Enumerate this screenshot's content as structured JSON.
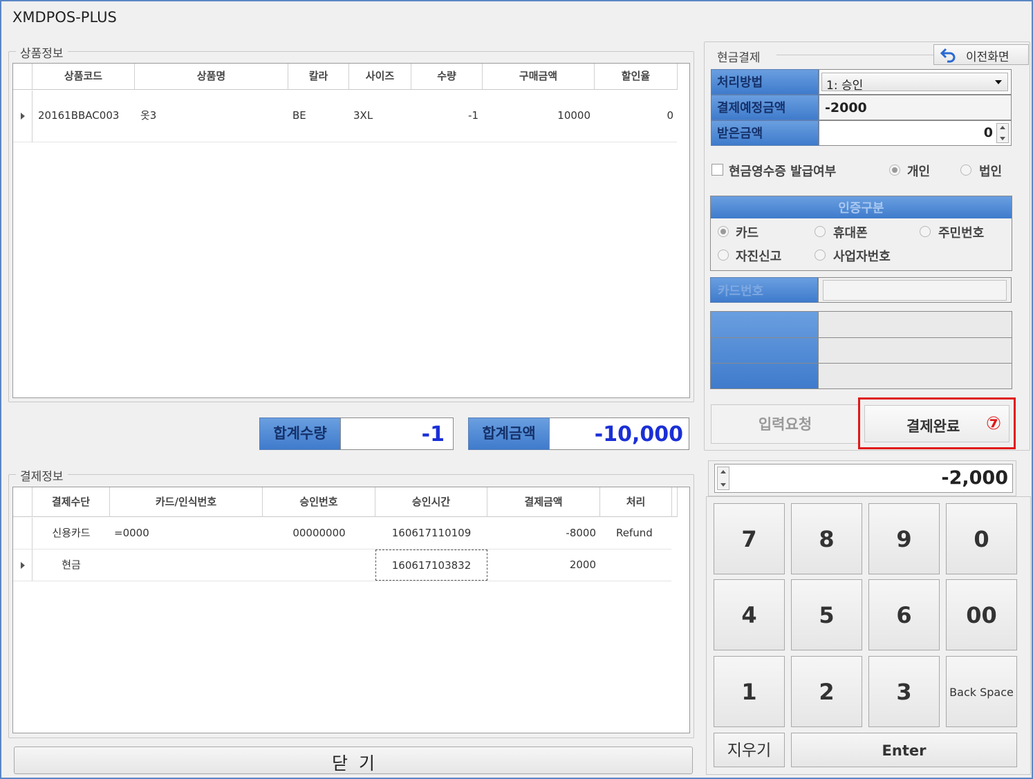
{
  "app": {
    "title": "XMDPOS-PLUS"
  },
  "product_info": {
    "legend": "상품정보",
    "columns": [
      "상품코드",
      "상품명",
      "칼라",
      "사이즈",
      "수량",
      "구매금액",
      "할인율"
    ],
    "rows": [
      {
        "code": "20161BBAC003",
        "name": "옷3",
        "color": "BE",
        "size": "3XL",
        "qty": "-1",
        "amount": "10000",
        "discount": "0"
      }
    ]
  },
  "totals": {
    "qty_label": "합계수량",
    "qty_value": "-1",
    "amount_label": "합계금액",
    "amount_value": "-10,000"
  },
  "payment_info": {
    "legend": "결제정보",
    "columns": [
      "결제수단",
      "카드/인식번호",
      "승인번호",
      "승인시간",
      "결제금액",
      "처리"
    ],
    "rows": [
      {
        "method": "신용카드",
        "card": "=0000",
        "approval_no": "00000000",
        "approval_time": "160617110109",
        "amount": "-8000",
        "process": "Refund"
      },
      {
        "method": "현금",
        "card": "",
        "approval_no": "",
        "approval_time": "160617103832",
        "amount": "2000",
        "process": ""
      }
    ]
  },
  "close_button": "닫  기",
  "cash_payment": {
    "legend": "현금결제",
    "back_button": "이전화면",
    "process_method_label": "처리방법",
    "process_method_value": "1: 승인",
    "expected_amount_label": "결제예정금액",
    "expected_amount_value": "-2000",
    "received_amount_label": "받은금액",
    "received_amount_value": "0",
    "receipt_checkbox_label": "현금영수증 발급여부",
    "receipt_type_personal": "개인",
    "receipt_type_business": "법인",
    "auth_type_title": "인증구분",
    "auth_options": [
      "카드",
      "휴대폰",
      "주민번호",
      "자진신고",
      "사업자번호"
    ],
    "card_number_label": "카드번호",
    "input_request_button": "입력요청",
    "complete_button": "결제완료",
    "annotation_marker": "⑦"
  },
  "keypad": {
    "display_value": "-2,000",
    "keys": [
      "7",
      "8",
      "9",
      "0",
      "4",
      "5",
      "6",
      "00",
      "1",
      "2",
      "3",
      "Back Space"
    ],
    "clear_label": "지우기",
    "enter_label": "Enter"
  },
  "colors": {
    "accent_blue": "#4a86d8",
    "total_value_blue": "#1a2fd6",
    "annotation_red": "#e01818"
  }
}
